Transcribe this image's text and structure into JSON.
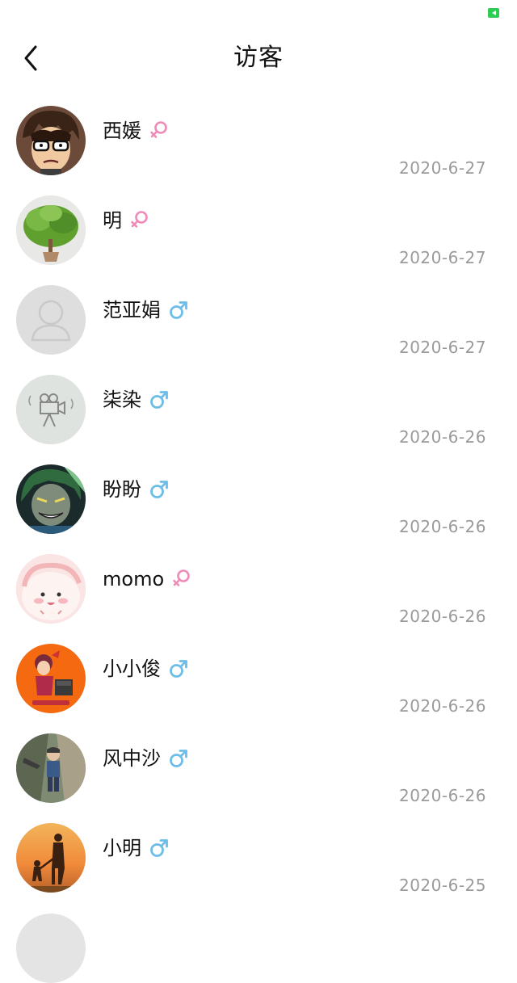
{
  "page": {
    "title": "访客"
  },
  "colors": {
    "female": "#f08ab8",
    "male": "#6cbde8",
    "date": "#9a9a9a",
    "battery": "#2ecc52"
  },
  "visitors": [
    {
      "name": "西媛",
      "gender": "female",
      "date": "2020-6-27",
      "avatar": "anime-boy-glasses"
    },
    {
      "name": "明",
      "gender": "female",
      "date": "2020-6-27",
      "avatar": "green-plant"
    },
    {
      "name": "范亚娟",
      "gender": "male",
      "date": "2020-6-27",
      "avatar": "default-silhouette"
    },
    {
      "name": "柒染",
      "gender": "male",
      "date": "2020-6-26",
      "avatar": "camera-sketch"
    },
    {
      "name": "盼盼",
      "gender": "male",
      "date": "2020-6-26",
      "avatar": "green-haired-villain"
    },
    {
      "name": "momo",
      "gender": "female",
      "date": "2020-6-26",
      "avatar": "pink-blob"
    },
    {
      "name": "小小俊",
      "gender": "male",
      "date": "2020-6-26",
      "avatar": "cartoon-orange"
    },
    {
      "name": "风中沙",
      "gender": "male",
      "date": "2020-6-26",
      "avatar": "child-photo"
    },
    {
      "name": "小明",
      "gender": "male",
      "date": "2020-6-25",
      "avatar": "sunset-silhouette"
    }
  ]
}
